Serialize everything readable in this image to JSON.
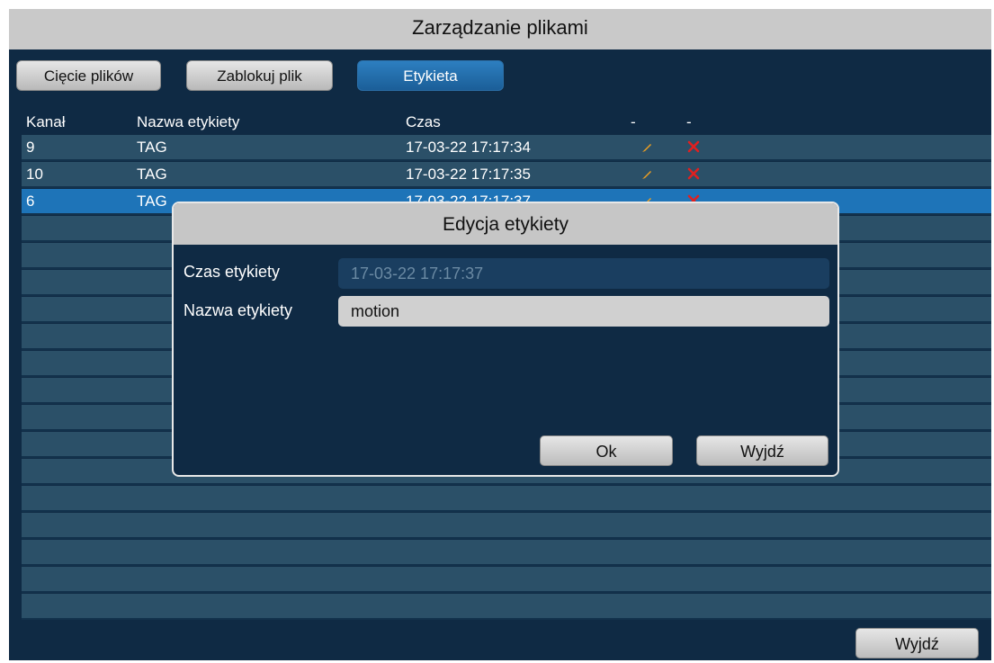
{
  "window": {
    "title": "Zarządzanie plikami"
  },
  "tabs": [
    {
      "label": "Cięcie plików",
      "active": false
    },
    {
      "label": "Zablokuj plik",
      "active": false
    },
    {
      "label": "Etykieta",
      "active": true
    }
  ],
  "table": {
    "columns": [
      "Kanał",
      "Nazwa etykiety",
      "Czas",
      "-",
      "-"
    ],
    "rows": [
      {
        "channel": "9",
        "name": "TAG",
        "time": "17-03-22 17:17:34",
        "edit_icon": "pencil-icon",
        "delete_icon": "delete-x-icon"
      },
      {
        "channel": "10",
        "name": "TAG",
        "time": "17-03-22 17:17:35",
        "edit_icon": "pencil-icon",
        "delete_icon": "delete-x-icon"
      },
      {
        "channel": "6",
        "name": "TAG",
        "time": "17-03-22 17:17:37",
        "edit_icon": "pencil-icon",
        "delete_icon": "delete-x-icon",
        "selected": true
      }
    ]
  },
  "dialog": {
    "title": "Edycja etykiety",
    "time_label": "Czas etykiety",
    "time_value": "17-03-22 17:17:37",
    "name_label": "Nazwa etykiety",
    "name_value": "motion",
    "ok_label": "Ok",
    "exit_label": "Wyjdź"
  },
  "footer": {
    "exit_label": "Wyjdź"
  },
  "colors": {
    "background": "#0f2a44",
    "row": "#2b5068",
    "selected_row": "#1e74b8",
    "active_tab": "#1e6aa8",
    "edit_icon": "#f0a020",
    "delete_icon": "#e02020"
  }
}
